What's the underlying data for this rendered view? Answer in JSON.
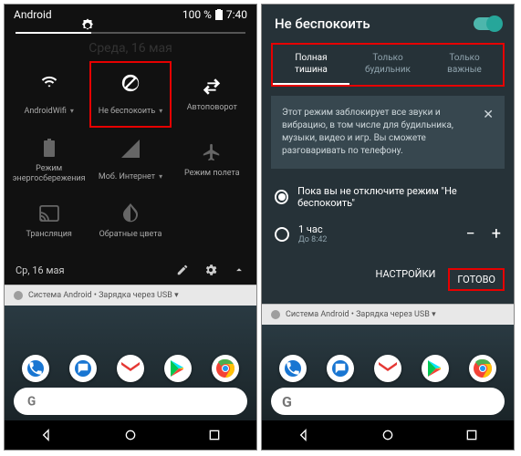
{
  "left": {
    "status": {
      "title": "Android",
      "battery": "100 %",
      "time": "7:40"
    },
    "date_faded": "Среда, 16 мая",
    "tiles": [
      {
        "label": "AndroidWifi",
        "dropdown": "▾"
      },
      {
        "label": "Не беспокоить",
        "dropdown": "▾"
      },
      {
        "label": "Автоповорот"
      },
      {
        "label": "Режим энергосбережения"
      },
      {
        "label": "Моб. Интернет",
        "dropdown": "▾"
      },
      {
        "label": "Режим полета"
      },
      {
        "label": "Трансляция"
      },
      {
        "label": "Обратные цвета"
      }
    ],
    "footer": {
      "date": "Ср, 16 мая"
    }
  },
  "right": {
    "title": "Не беспокоить",
    "tabs": [
      {
        "l1": "Полная",
        "l2": "тишина"
      },
      {
        "l1": "Только",
        "l2": "будильник"
      },
      {
        "l1": "Только",
        "l2": "важные"
      }
    ],
    "info": "Этот режим заблокирует все звуки и вибрацию, в том числе для будильника, музыки, видео и игр. Вы сможете разговаривать по телефону.",
    "radio1": "Пока вы не отключите режим \"Не беспокоить\"",
    "radio2_label": "1 час",
    "radio2_sub": "До 8:42",
    "actions": {
      "settings": "НАСТРОЙКИ",
      "done": "ГОТОВО"
    }
  },
  "notif": "Система Android • Зарядка через USB ▾",
  "search_letter": "G"
}
